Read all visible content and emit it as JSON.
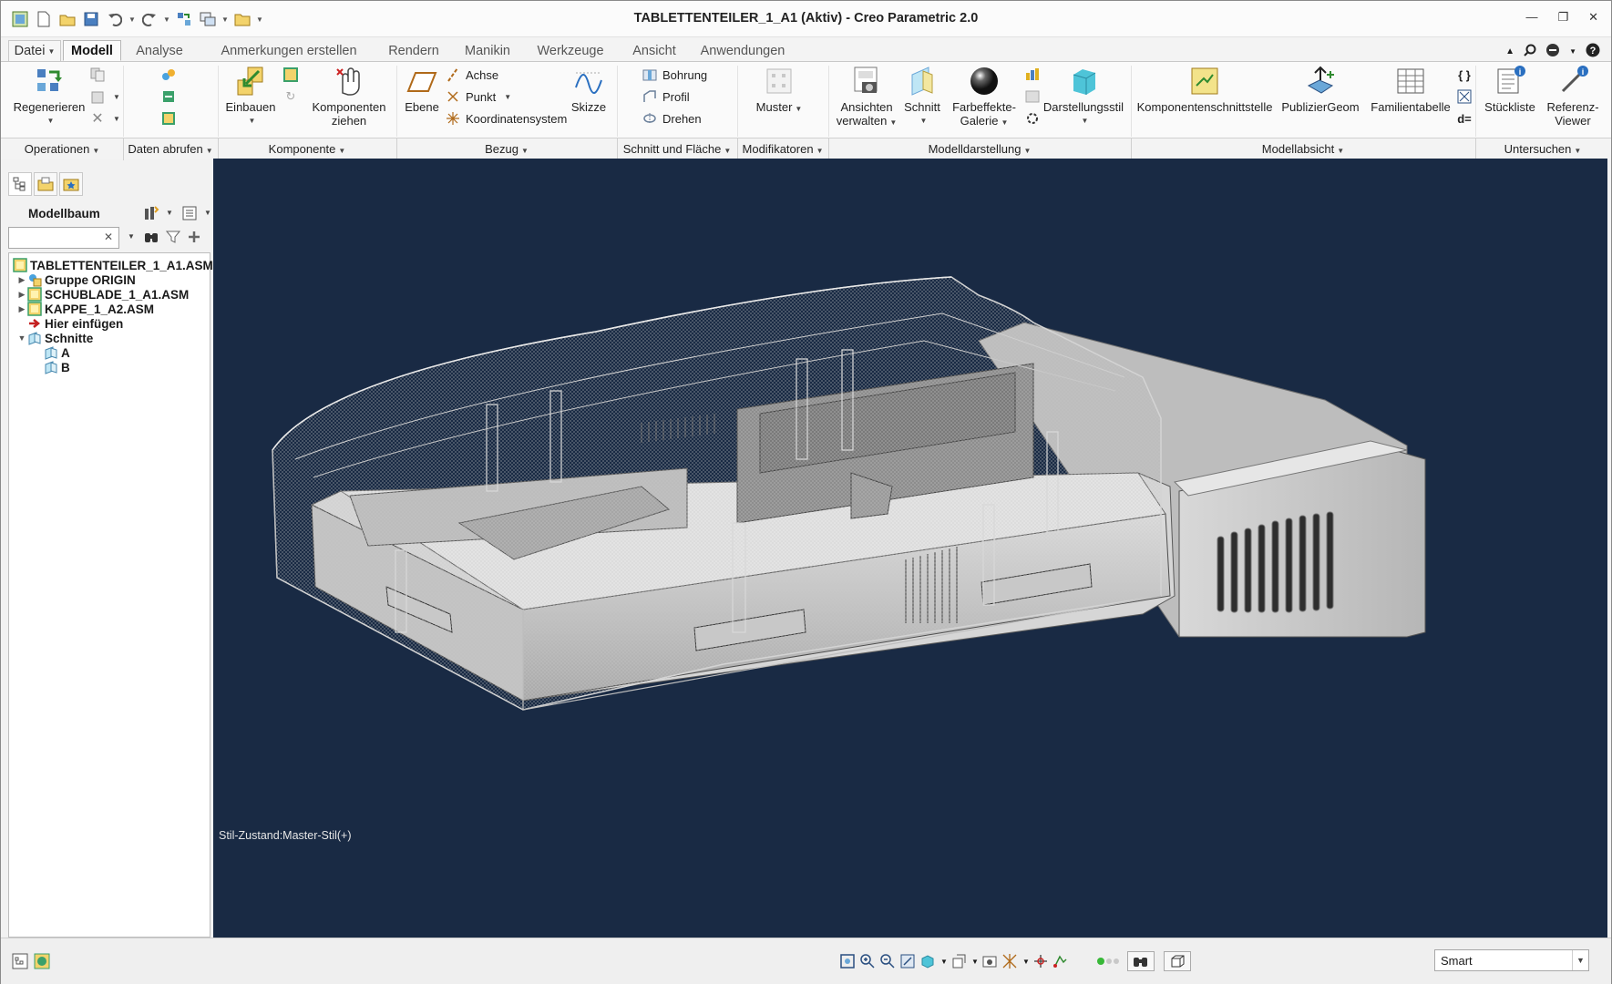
{
  "window": {
    "title": "TABLETTENTEILER_1_A1 (Aktiv) - Creo Parametric 2.0",
    "controls": [
      "minimize-icon",
      "restore-icon",
      "close-icon"
    ]
  },
  "tabs": [
    {
      "label": "Datei"
    },
    {
      "label": "Modell"
    },
    {
      "label": "Analyse"
    },
    {
      "label": "Anmerkungen erstellen"
    },
    {
      "label": "Rendern"
    },
    {
      "label": "Manikin"
    },
    {
      "label": "Werkzeuge"
    },
    {
      "label": "Ansicht"
    },
    {
      "label": "Anwendungen"
    }
  ],
  "ribbon": {
    "regenerieren": "Regenerieren",
    "einbauen": "Einbauen",
    "komponenten_ziehen": [
      "Komponenten",
      "ziehen"
    ],
    "ebene": "Ebene",
    "achse": "Achse",
    "punkt": "Punkt",
    "koordinatensystem": "Koordinatensystem",
    "skizze": "Skizze",
    "bohrung": "Bohrung",
    "profil": "Profil",
    "drehen": "Drehen",
    "muster": "Muster",
    "ansichten_verwalten": [
      "Ansichten",
      "verwalten"
    ],
    "schnitt": "Schnitt",
    "farbeffekte": [
      "Farbeffekte-",
      "Galerie"
    ],
    "darstellungsstil": "Darstellungsstil",
    "komponentenschnittstelle": "Komponentenschnittstelle",
    "publiziergeom": "PublizierGeom",
    "familientabelle": "Familientabelle",
    "stueckliste": "Stückliste",
    "referenz_viewer": [
      "Referenz-",
      "Viewer"
    ],
    "d_equals": "d="
  },
  "groups": {
    "operationen": "Operationen",
    "daten_abrufen": "Daten abrufen",
    "komponente": "Komponente",
    "bezug": "Bezug",
    "schnitt_flaeche": "Schnitt und Fläche",
    "modifikatoren": "Modifikatoren",
    "modelldarstellung": "Modelldarstellung",
    "modellabsicht": "Modellabsicht",
    "untersuchen": "Untersuchen"
  },
  "panel": {
    "title": "Modellbaum",
    "search_value": "",
    "tree": [
      {
        "label": "TABLETTENTEILER_1_A1.ASM",
        "icon": "assembly-icon"
      },
      {
        "label": "Gruppe ORIGIN",
        "icon": "group-icon"
      },
      {
        "label": "SCHUBLADE_1_A1.ASM",
        "icon": "assembly-icon"
      },
      {
        "label": "KAPPE_1_A2.ASM",
        "icon": "assembly-icon"
      },
      {
        "label": "Hier einfügen",
        "icon": "insert-arrow-icon"
      },
      {
        "label": "Schnitte",
        "icon": "sections-folder-icon"
      },
      {
        "label": "A",
        "icon": "section-icon"
      },
      {
        "label": "B",
        "icon": "section-icon"
      }
    ]
  },
  "viewport": {
    "background": "#192a44",
    "style_state": "Stil-Zustand:Master-Stil(+)"
  },
  "statusbar": {
    "selection_filter": "Smart",
    "status_light_color": "#38b838"
  }
}
